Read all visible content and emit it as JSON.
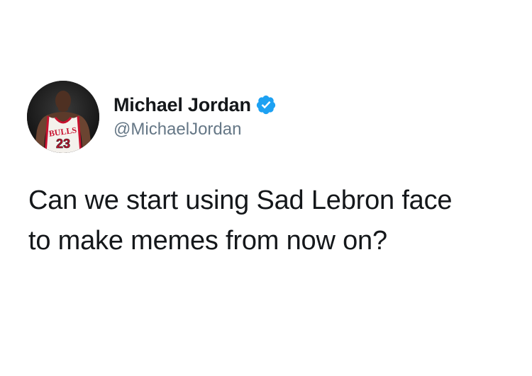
{
  "tweet": {
    "author": {
      "display_name": "Michael Jordan",
      "handle": "@MichaelJordan",
      "verified": true,
      "avatar_jersey_text": "BULLS",
      "avatar_jersey_number": "23"
    },
    "text_line_1": "Can we start using Sad Lebron face",
    "text_line_2": "to make memes from now on?"
  },
  "colors": {
    "text": "#14171a",
    "handle": "#657786",
    "verified_badge": "#1da1f2",
    "background": "#ffffff"
  },
  "icons": {
    "verified": "verified-badge-icon",
    "avatar": "profile-photo"
  }
}
